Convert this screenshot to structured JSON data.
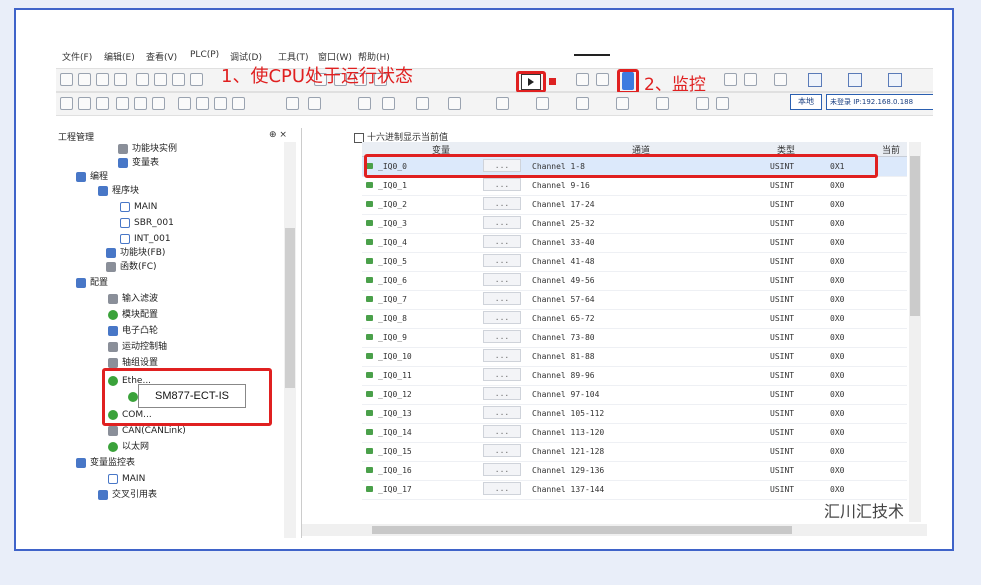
{
  "menu": [
    "文件(F)",
    "编辑(E)",
    "查看(V)",
    "PLC(P)",
    "调试(D)",
    "工具(T)",
    "窗口(W)",
    "帮助(H)"
  ],
  "annotation_1": "1、使CPU处于运行状态",
  "annotation_2": "2、监控",
  "toolbar": {
    "local_label": "本地",
    "login_label": "未登录 IP:192.168.0.188"
  },
  "left_panel": {
    "title": "工程管理",
    "controls": "⊕ ×",
    "items": [
      {
        "label": "功能块实例",
        "icon": "instance-icon"
      },
      {
        "label": "变量表",
        "icon": "table-icon"
      },
      {
        "label": "编程",
        "icon": "program-icon"
      },
      {
        "label": "程序块",
        "icon": "block-icon"
      },
      {
        "label": "MAIN",
        "icon": "doc-icon"
      },
      {
        "label": "SBR_001",
        "icon": "doc-icon"
      },
      {
        "label": "INT_001",
        "icon": "doc-icon"
      },
      {
        "label": "功能块(FB)",
        "icon": "fb-icon"
      },
      {
        "label": "函数(FC)",
        "icon": "fc-icon"
      },
      {
        "label": "配置",
        "icon": "config-icon"
      },
      {
        "label": "输入滤波",
        "icon": "filter-icon"
      },
      {
        "label": "模块配置",
        "icon": "check-icon"
      },
      {
        "label": "电子凸轮",
        "icon": "cam-icon"
      },
      {
        "label": "运动控制轴",
        "icon": "axis-icon"
      },
      {
        "label": "轴组设置",
        "icon": "axisgroup-icon"
      },
      {
        "label": "Ethe...",
        "icon": "check-icon"
      },
      {
        "label": "",
        "icon": "check-icon"
      },
      {
        "label": "COM...",
        "icon": "check-icon"
      },
      {
        "label": "CAN(CANLink)",
        "icon": "can-icon"
      },
      {
        "label": "以太网",
        "icon": "check-icon"
      },
      {
        "label": "变量监控表",
        "icon": "monitor-icon"
      },
      {
        "label": "MAIN",
        "icon": "doc-icon"
      },
      {
        "label": "交叉引用表",
        "icon": "xref-icon"
      }
    ],
    "tooltip": "SM877-ECT-IS"
  },
  "main": {
    "checkbox_label": "十六进制显示当前值",
    "headers": [
      "变量",
      "通道",
      "类型",
      "当前"
    ],
    "rows": [
      {
        "var": "_IQ0_0",
        "ch": "Channel 1-8",
        "type": "USINT",
        "val": "0X1"
      },
      {
        "var": "_IQ0_1",
        "ch": "Channel 9-16",
        "type": "USINT",
        "val": "0X0"
      },
      {
        "var": "_IQ0_2",
        "ch": "Channel 17-24",
        "type": "USINT",
        "val": "0X0"
      },
      {
        "var": "_IQ0_3",
        "ch": "Channel 25-32",
        "type": "USINT",
        "val": "0X0"
      },
      {
        "var": "_IQ0_4",
        "ch": "Channel 33-40",
        "type": "USINT",
        "val": "0X0"
      },
      {
        "var": "_IQ0_5",
        "ch": "Channel 41-48",
        "type": "USINT",
        "val": "0X0"
      },
      {
        "var": "_IQ0_6",
        "ch": "Channel 49-56",
        "type": "USINT",
        "val": "0X0"
      },
      {
        "var": "_IQ0_7",
        "ch": "Channel 57-64",
        "type": "USINT",
        "val": "0X0"
      },
      {
        "var": "_IQ0_8",
        "ch": "Channel 65-72",
        "type": "USINT",
        "val": "0X0"
      },
      {
        "var": "_IQ0_9",
        "ch": "Channel 73-80",
        "type": "USINT",
        "val": "0X0"
      },
      {
        "var": "_IQ0_10",
        "ch": "Channel 81-88",
        "type": "USINT",
        "val": "0X0"
      },
      {
        "var": "_IQ0_11",
        "ch": "Channel 89-96",
        "type": "USINT",
        "val": "0X0"
      },
      {
        "var": "_IQ0_12",
        "ch": "Channel 97-104",
        "type": "USINT",
        "val": "0X0"
      },
      {
        "var": "_IQ0_13",
        "ch": "Channel 105-112",
        "type": "USINT",
        "val": "0X0"
      },
      {
        "var": "_IQ0_14",
        "ch": "Channel 113-120",
        "type": "USINT",
        "val": "0X0"
      },
      {
        "var": "_IQ0_15",
        "ch": "Channel 121-128",
        "type": "USINT",
        "val": "0X0"
      },
      {
        "var": "_IQ0_16",
        "ch": "Channel 129-136",
        "type": "USINT",
        "val": "0X0"
      },
      {
        "var": "_IQ0_17",
        "ch": "Channel 137-144",
        "type": "USINT",
        "val": "0X0"
      }
    ],
    "dots": "...",
    "watermark": "汇川汇技术"
  }
}
